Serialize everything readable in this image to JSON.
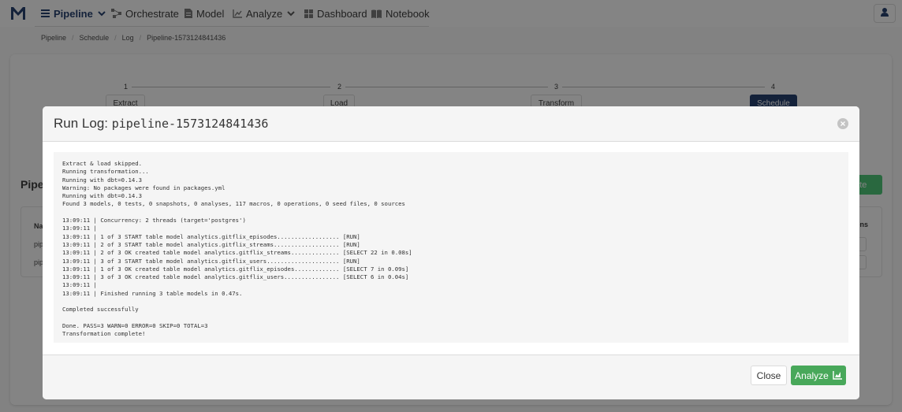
{
  "nav": {
    "items": [
      {
        "label": "Pipeline"
      },
      {
        "label": "Orchestrate"
      },
      {
        "label": "Model"
      },
      {
        "label": "Analyze"
      },
      {
        "label": "Dashboard"
      },
      {
        "label": "Notebook"
      }
    ]
  },
  "breadcrumb": [
    "Pipeline",
    "Schedule",
    "Log",
    "Pipeline-1573124841436"
  ],
  "steps": [
    {
      "number": "1",
      "label": "Extract"
    },
    {
      "number": "2",
      "label": "Load"
    },
    {
      "number": "3",
      "label": "Transform"
    },
    {
      "number": "4",
      "label": "Schedule"
    }
  ],
  "background": {
    "heading_fragment": "Pipel",
    "create_fragment": "eate",
    "col1_fragment": "Na",
    "col_last_fragment": "ons",
    "row1_fragment": "pip",
    "row2_fragment": "pip"
  },
  "modal": {
    "title_prefix": "Run Log:",
    "title_name": "pipeline-1573124841436",
    "log_lines": [
      "Extract & load skipped.",
      "Running transformation...",
      "Running with dbt=0.14.3",
      "Warning: No packages were found in packages.yml",
      "Running with dbt=0.14.3",
      "Found 3 models, 0 tests, 0 snapshots, 0 analyses, 117 macros, 0 operations, 0 seed files, 0 sources",
      "",
      "13:09:11 | Concurrency: 2 threads (target='postgres')",
      "13:09:11 |",
      "13:09:11 | 1 of 3 START table model analytics.gitflix_episodes.................. [RUN]",
      "13:09:11 | 2 of 3 START table model analytics.gitflix_streams................... [RUN]",
      "13:09:11 | 2 of 3 OK created table model analytics.gitflix_streams.............. [SELECT 22 in 0.08s]",
      "13:09:11 | 3 of 3 START table model analytics.gitflix_users..................... [RUN]",
      "13:09:11 | 1 of 3 OK created table model analytics.gitflix_episodes............. [SELECT 7 in 0.09s]",
      "13:09:11 | 3 of 3 OK created table model analytics.gitflix_users................ [SELECT 6 in 0.04s]",
      "13:09:11 |",
      "13:09:11 | Finished running 3 table models in 0.47s.",
      "",
      "Completed successfully",
      "",
      "Done. PASS=3 WARN=0 ERROR=0 SKIP=0 TOTAL=3",
      "Transformation complete!"
    ],
    "close_label": "Close",
    "analyze_label": "Analyze"
  },
  "colors": {
    "brand": "#1f3a6b",
    "success": "#48a85a"
  }
}
